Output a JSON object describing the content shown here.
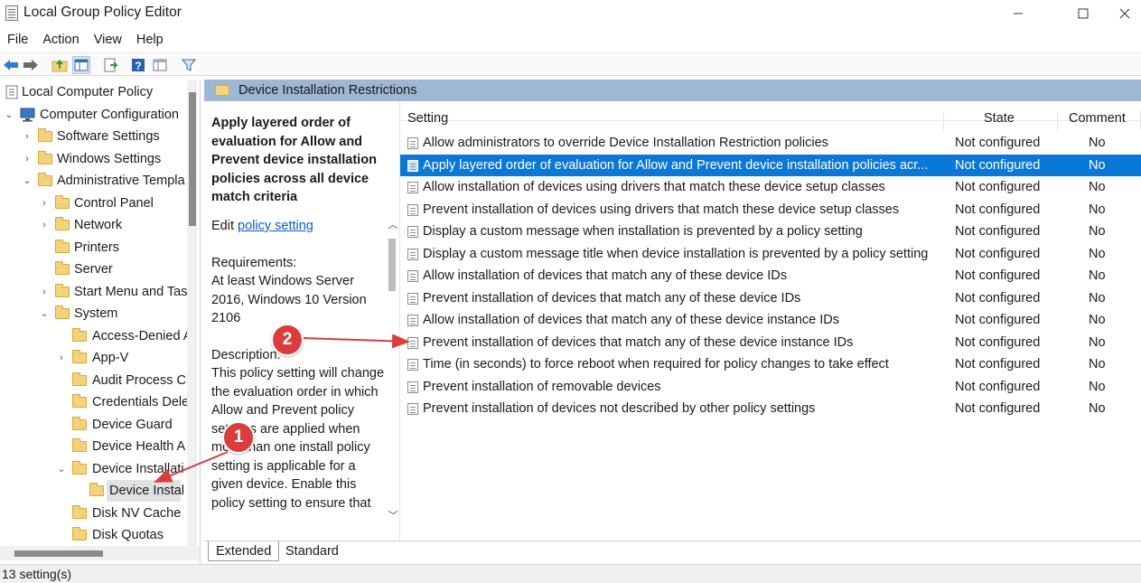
{
  "window": {
    "title": "Local Group Policy Editor",
    "controls": [
      "minimize",
      "maximize",
      "close"
    ]
  },
  "menu": [
    "File",
    "Action",
    "Help",
    "View"
  ],
  "menu_order": [
    "File",
    "Action",
    "View",
    "Help"
  ],
  "toolbar": {
    "icons": [
      "back-icon",
      "forward-icon",
      "up-folder-icon",
      "show-hide-tree-icon",
      "export-list-icon",
      "help-icon",
      "properties-icon",
      "filter-icon"
    ]
  },
  "tree": {
    "root": "Local Computer Policy",
    "items": [
      {
        "label": "Local Computer Policy"
      },
      {
        "label": "Computer Configuration"
      },
      {
        "label": "Software Settings"
      },
      {
        "label": "Windows Settings"
      },
      {
        "label": "Administrative Templa"
      },
      {
        "label": "Control Panel"
      },
      {
        "label": "Network"
      },
      {
        "label": "Printers"
      },
      {
        "label": "Server"
      },
      {
        "label": "Start Menu and Tas"
      },
      {
        "label": "System"
      },
      {
        "label": "Access-Denied A"
      },
      {
        "label": "App-V"
      },
      {
        "label": "Audit Process C"
      },
      {
        "label": "Credentials Dele"
      },
      {
        "label": "Device Guard"
      },
      {
        "label": "Device Health A"
      },
      {
        "label": "Device Installati"
      },
      {
        "label": "Device Instal"
      },
      {
        "label": "Disk NV Cache"
      },
      {
        "label": "Disk Quotas"
      }
    ]
  },
  "panel_header": "Device Installation Restrictions",
  "description": {
    "title": "Apply layered order of evaluation for Allow and Prevent device installation policies across all device match criteria",
    "edit_prefix": "Edit",
    "edit_link": "policy setting",
    "requirements_label": "Requirements:",
    "requirements_text": "At least Windows Server 2016, Windows 10 Version 2106",
    "description_label": "Description:",
    "description_text": "This policy setting will change the evaluation order in which Allow and Prevent policy settings are applied when more than one install policy setting is applicable for a given device. Enable this policy setting to ensure that"
  },
  "grid": {
    "headers": {
      "setting": "Setting",
      "state": "State",
      "comment": "Comment"
    },
    "rows": [
      {
        "name": "Allow administrators to override Device Installation Restriction policies",
        "state": "Not configured",
        "comment": "No"
      },
      {
        "name": "Apply layered order of evaluation for Allow and Prevent device installation policies acr...",
        "state": "Not configured",
        "comment": "No"
      },
      {
        "name": "Allow installation of devices using drivers that match these device setup classes",
        "state": "Not configured",
        "comment": "No"
      },
      {
        "name": "Prevent installation of devices using drivers that match these device setup classes",
        "state": "Not configured",
        "comment": "No"
      },
      {
        "name": "Display a custom message when installation is prevented by a policy setting",
        "state": "Not configured",
        "comment": "No"
      },
      {
        "name": "Display a custom message title when device installation is prevented by a policy setting",
        "state": "Not configured",
        "comment": "No"
      },
      {
        "name": "Allow installation of devices that match any of these device IDs",
        "state": "Not configured",
        "comment": "No"
      },
      {
        "name": "Prevent installation of devices that match any of these device IDs",
        "state": "Not configured",
        "comment": "No"
      },
      {
        "name": "Allow installation of devices that match any of these device instance IDs",
        "state": "Not configured",
        "comment": "No"
      },
      {
        "name": "Prevent installation of devices that match any of these device instance IDs",
        "state": "Not configured",
        "comment": "No"
      },
      {
        "name": "Time (in seconds) to force reboot when required for policy changes to take effect",
        "state": "Not configured",
        "comment": "No"
      },
      {
        "name": "Prevent installation of removable devices",
        "state": "Not configured",
        "comment": "No"
      },
      {
        "name": "Prevent installation of devices not described by other policy settings",
        "state": "Not configured",
        "comment": "No"
      }
    ]
  },
  "tabs": [
    "Extended",
    "Standard"
  ],
  "status": "13 setting(s)",
  "annotations": {
    "badge_1": "1",
    "badge_2": "2",
    "color": "#d93d3d"
  },
  "colors": {
    "selection": "#0a78d7",
    "header_band": "#9eb7d4",
    "link": "#0b5cc8"
  }
}
